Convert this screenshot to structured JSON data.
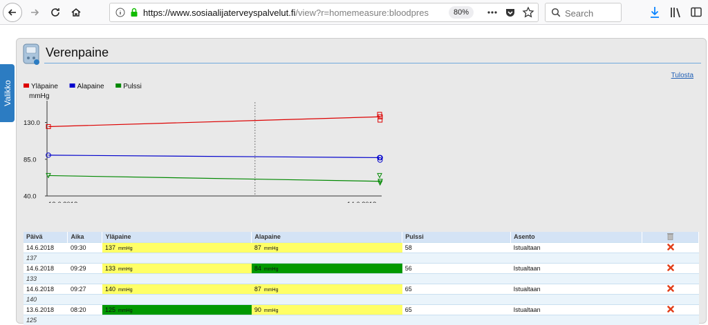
{
  "browser": {
    "url_domain": "https://www.sosiaalijaterveyspalvelut.fi",
    "url_path": "/view?r=homemeasure:bloodpres",
    "zoom": "80%",
    "search_placeholder": "Search"
  },
  "side_tab": {
    "label": "Valikko"
  },
  "page": {
    "title": "Verenpaine",
    "print_label": "Tulosta"
  },
  "chart_data": {
    "type": "line",
    "unit_label": "mmHg",
    "legend": [
      "Yläpaine",
      "Alapaine",
      "Pulssi"
    ],
    "x_ticks": [
      "13.6.2018",
      "14.6.2018"
    ],
    "y_ticks": [
      "130.0",
      "85.0",
      "40.0"
    ],
    "ylim": [
      40,
      155
    ],
    "series": [
      {
        "name": "Yläpaine",
        "color": "#dd0000",
        "x": [
          "13.6.2018 08:20",
          "14.6.2018 09:27",
          "14.6.2018 09:29",
          "14.6.2018 09:30"
        ],
        "values": [
          125,
          140,
          133,
          137
        ]
      },
      {
        "name": "Alapaine",
        "color": "#0000cc",
        "x": [
          "13.6.2018 08:20",
          "14.6.2018 09:27",
          "14.6.2018 09:29",
          "14.6.2018 09:30"
        ],
        "values": [
          90,
          87,
          84,
          87
        ]
      },
      {
        "name": "Pulssi",
        "color": "#008800",
        "x": [
          "13.6.2018 08:20",
          "14.6.2018 09:27",
          "14.6.2018 09:29",
          "14.6.2018 09:30"
        ],
        "values": [
          65,
          65,
          56,
          58
        ]
      }
    ]
  },
  "table": {
    "headers": [
      "Päivä",
      "Aika",
      "Yläpaine",
      "Alapaine",
      "Pulssi",
      "Asento"
    ],
    "unit": "mmHg",
    "rows": [
      {
        "date": "14.6.2018",
        "time": "09:30",
        "systolic": "137",
        "diastolic": "87",
        "pulse": "58",
        "position": "Istualtaan",
        "note": "137"
      },
      {
        "date": "14.6.2018",
        "time": "09:29",
        "systolic": "133",
        "diastolic": "84",
        "pulse": "56",
        "position": "Istualtaan",
        "note": "133"
      },
      {
        "date": "14.6.2018",
        "time": "09:27",
        "systolic": "140",
        "diastolic": "87",
        "pulse": "65",
        "position": "Istualtaan",
        "note": "140"
      },
      {
        "date": "13.6.2018",
        "time": "08:20",
        "systolic": "125",
        "diastolic": "90",
        "pulse": "65",
        "position": "Istualtaan",
        "note": "125"
      }
    ]
  },
  "colors": {
    "accent": "#2c7cc2",
    "header_bg": "#d4e3f5",
    "warn": "#ffff66",
    "ok": "#009900"
  }
}
